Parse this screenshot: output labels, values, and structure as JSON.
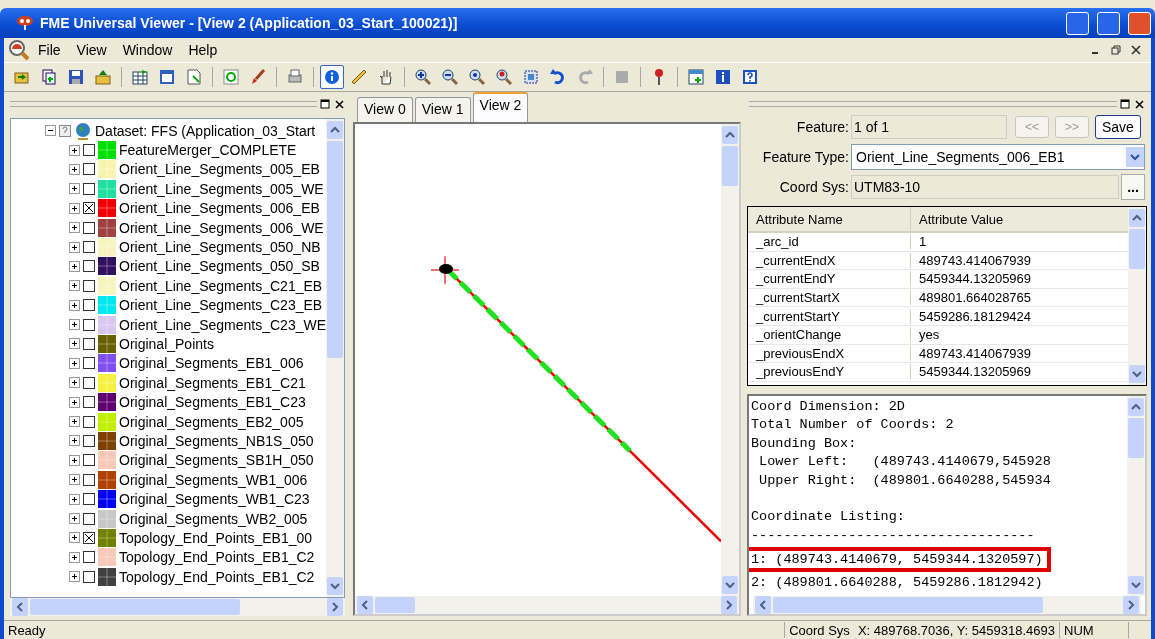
{
  "window": {
    "title": "FME Universal Viewer - [View 2 (Application_03_Start_100021)]"
  },
  "menu": [
    "File",
    "View",
    "Window",
    "Help"
  ],
  "tree": {
    "root": "Dataset: FFS (Application_03_Start",
    "expanded": true,
    "children": [
      {
        "label": "FeatureMerger_COMPLETE",
        "checked": false,
        "color": "#00e000"
      },
      {
        "label": "Orient_Line_Segments_005_EB",
        "checked": false,
        "color": "#f8f4b0"
      },
      {
        "label": "Orient_Line_Segments_005_WE",
        "checked": false,
        "color": "#20e0a0"
      },
      {
        "label": "Orient_Line_Segments_006_EB",
        "checked": true,
        "color": "#f00000"
      },
      {
        "label": "Orient_Line_Segments_006_WE",
        "checked": false,
        "color": "#a04040"
      },
      {
        "label": "Orient_Line_Segments_050_NB",
        "checked": false,
        "color": "#f8f4c0"
      },
      {
        "label": "Orient_Line_Segments_050_SB",
        "checked": false,
        "color": "#301060"
      },
      {
        "label": "Orient_Line_Segments_C21_EB",
        "checked": false,
        "color": "#f8f4c0"
      },
      {
        "label": "Orient_Line_Segments_C23_EB",
        "checked": false,
        "color": "#00e8f0"
      },
      {
        "label": "Orient_Line_Segments_C23_WE",
        "checked": false,
        "color": "#d8c8f0"
      },
      {
        "label": "Original_Points",
        "checked": false,
        "color": "#686000"
      },
      {
        "label": "Original_Segments_EB1_006",
        "checked": false,
        "color": "#8050f0"
      },
      {
        "label": "Original_Segments_EB1_C21",
        "checked": false,
        "color": "#f8f040"
      },
      {
        "label": "Original_Segments_EB1_C23",
        "checked": false,
        "color": "#600070"
      },
      {
        "label": "Original_Segments_EB2_005",
        "checked": false,
        "color": "#c0f000"
      },
      {
        "label": "Original_Segments_NB1S_050",
        "checked": false,
        "color": "#804000"
      },
      {
        "label": "Original_Segments_SB1H_050",
        "checked": false,
        "color": "#f8c8b8"
      },
      {
        "label": "Original_Segments_WB1_006",
        "checked": false,
        "color": "#b04000"
      },
      {
        "label": "Original_Segments_WB1_C23",
        "checked": false,
        "color": "#0000f0"
      },
      {
        "label": "Original_Segments_WB2_005",
        "checked": false,
        "color": "#c8c8c8"
      },
      {
        "label": "Topology_End_Points_EB1_00",
        "checked": true,
        "color": "#708000"
      },
      {
        "label": "Topology_End_Points_EB1_C2",
        "checked": false,
        "color": "#f8c8b8"
      },
      {
        "label": "Topology_End_Points_EB1_C2",
        "checked": false,
        "color": "#404040"
      }
    ]
  },
  "view_tabs": [
    {
      "label": "View 0",
      "selected": false
    },
    {
      "label": "View 1",
      "selected": false
    },
    {
      "label": "View 2",
      "selected": true
    }
  ],
  "feature": {
    "label": "Feature:",
    "value": "1 of 1",
    "prev": "<<",
    "next": ">>",
    "save": "Save",
    "type_label": "Feature Type:",
    "type_value": "Orient_Line_Segments_006_EB1",
    "coord_label": "Coord Sys:",
    "coord_value": "UTM83-10",
    "browse": "..."
  },
  "attributes": {
    "columns": [
      "Attribute Name",
      "Attribute Value"
    ],
    "rows": [
      [
        "_arc_id",
        "1"
      ],
      [
        "_currentEndX",
        "489743.414067939"
      ],
      [
        "_currentEndY",
        "5459344.13205969"
      ],
      [
        "_currentStartX",
        "489801.664028765"
      ],
      [
        "_currentStartY",
        "5459286.18129424"
      ],
      [
        "_orientChange",
        "yes"
      ],
      [
        "_previousEndX",
        "489743.414067939"
      ],
      [
        "_previousEndY",
        "5459344.13205969"
      ]
    ]
  },
  "geometry_text": [
    {
      "text": "Coord Dimension: 2D",
      "highlighted": false
    },
    {
      "text": "Total Number of Coords: 2",
      "highlighted": false
    },
    {
      "text": "Bounding Box:",
      "highlighted": false
    },
    {
      "text": " Lower Left:   (489743.4140679,545928",
      "highlighted": false
    },
    {
      "text": " Upper Right:  (489801.6640288,545934",
      "highlighted": false
    },
    {
      "text": "Coordinate Listing:",
      "highlighted": false,
      "blank_before": true
    },
    {
      "text": "-----------------------------------",
      "highlighted": false
    },
    {
      "text": "1: (489743.4140679, 5459344.1320597)",
      "highlighted": true
    },
    {
      "text": "2: (489801.6640288, 5459286.1812942)",
      "highlighted": false
    }
  ],
  "status_bar": {
    "message": "Ready",
    "coord_sys": "Coord Sys",
    "position": "X: 489768.7036, Y: 5459318.4693",
    "num": "NUM"
  }
}
